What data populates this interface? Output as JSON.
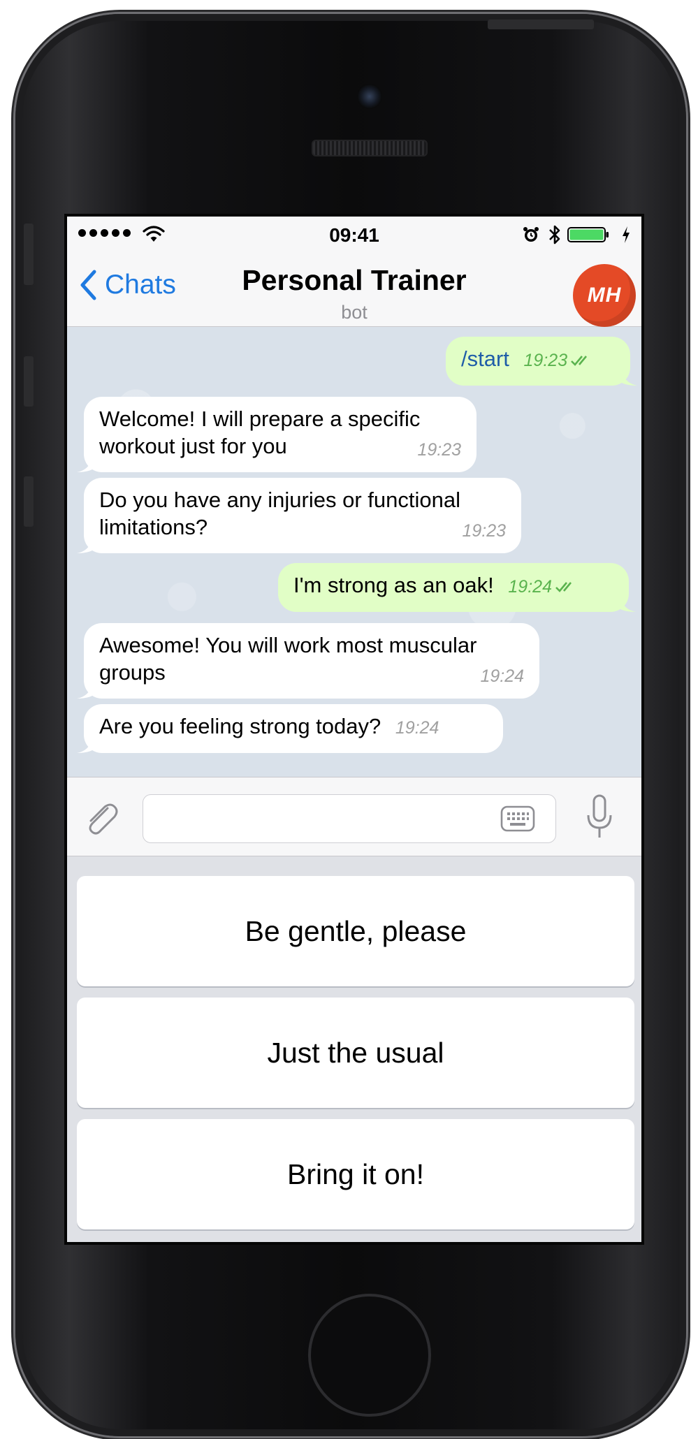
{
  "status_bar": {
    "time": "09:41",
    "icons": [
      "signal-dots-icon",
      "wifi-icon",
      "alarm-icon",
      "bluetooth-icon",
      "battery-icon",
      "charging-bolt-icon"
    ]
  },
  "nav": {
    "back_label": "Chats",
    "title": "Personal Trainer",
    "subtitle": "bot",
    "avatar_text": "MH",
    "avatar_color": "#e44a26"
  },
  "messages": [
    {
      "direction": "out",
      "text": "/start",
      "time": "19:23",
      "status": "read"
    },
    {
      "direction": "in",
      "text": "Welcome! I will prepare a specific workout just for you",
      "time": "19:23"
    },
    {
      "direction": "in",
      "text": "Do you have any injuries or functional limitations?",
      "time": "19:23"
    },
    {
      "direction": "out",
      "text": "I'm strong as an oak!",
      "time": "19:24",
      "status": "read"
    },
    {
      "direction": "in",
      "text": "Awesome! You will work most muscular groups",
      "time": "19:24"
    },
    {
      "direction": "in",
      "text": "Are you feeling strong today?",
      "time": "19:24"
    }
  ],
  "input": {
    "value": "",
    "placeholder": ""
  },
  "reply_keyboard": {
    "buttons": [
      "Be gentle, please",
      "Just the usual",
      "Bring it on!"
    ]
  },
  "colors": {
    "accent": "#1f7ae0",
    "outgoing_bubble": "#e1fec6",
    "incoming_bubble": "#ffffff",
    "outgoing_time": "#5ab34e",
    "chat_background": "#d9e1ea"
  }
}
